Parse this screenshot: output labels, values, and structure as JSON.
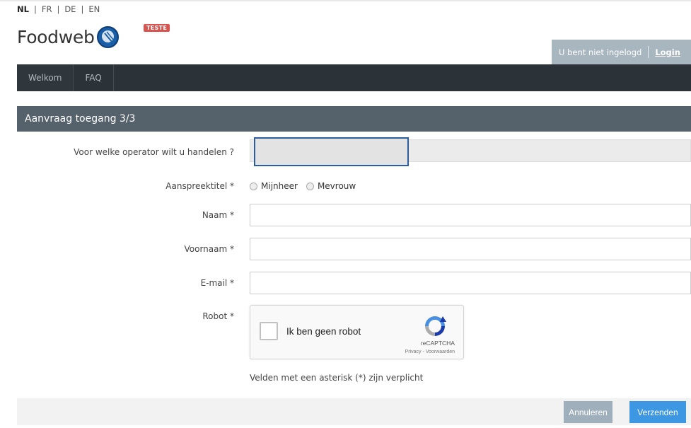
{
  "languages": [
    {
      "code": "NL",
      "active": true
    },
    {
      "code": "FR",
      "active": false
    },
    {
      "code": "DE",
      "active": false
    },
    {
      "code": "EN",
      "active": false
    }
  ],
  "language_separator": "|",
  "brand": {
    "name": "Foodweb",
    "badge": "TESTE",
    "logo_icon": "fork-knife-icon"
  },
  "user": {
    "status": "U bent niet ingelogd",
    "login_label": "Login"
  },
  "nav": {
    "items": [
      "Welkom",
      "FAQ"
    ]
  },
  "panel": {
    "title": "Aanvraag toegang 3/3"
  },
  "form": {
    "operator": {
      "label": "Voor welke operator wilt u handelen ?",
      "value": ""
    },
    "salutation": {
      "label": "Aanspreektitel *",
      "options": [
        "Mijnheer",
        "Mevrouw"
      ],
      "selected": null
    },
    "last_name": {
      "label": "Naam *",
      "value": ""
    },
    "first_name": {
      "label": "Voornaam *",
      "value": ""
    },
    "email": {
      "label": "E-mail *",
      "value": ""
    },
    "robot": {
      "label": "Robot *",
      "checkbox_text": "Ik ben geen robot",
      "brand": "reCAPTCHA",
      "links": "Privacy - Voorwaarden",
      "checked": false
    },
    "required_note": "Velden met een asterisk (*) zijn verplicht"
  },
  "actions": {
    "cancel_label": "Annuleren",
    "submit_label": "Verzenden"
  },
  "colors": {
    "nav_bg": "#2c3338",
    "panel_header_bg": "#56626b",
    "user_status_bg": "#a8b6bf",
    "submit_bg": "#3d97e3",
    "cancel_bg": "#9fb0bc",
    "badge_bg": "#d9534f"
  }
}
